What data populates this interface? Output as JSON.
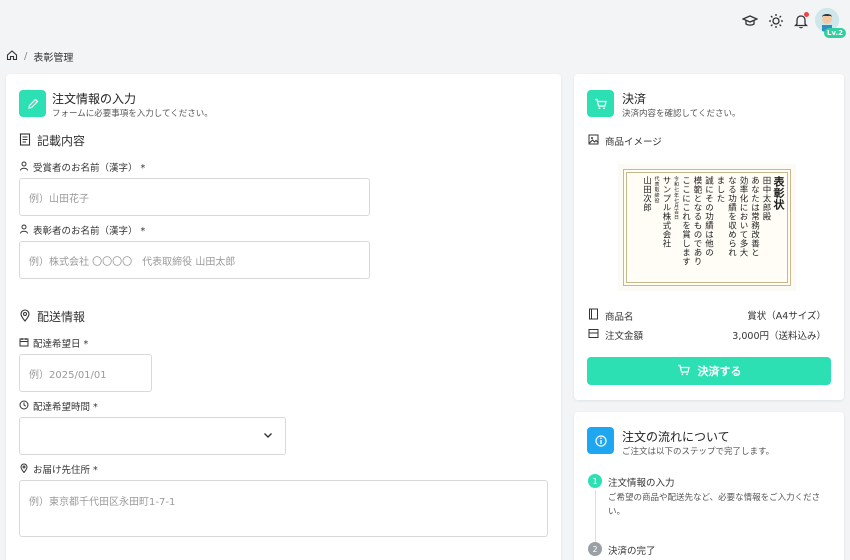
{
  "topbar": {
    "icons": [
      "graduation-cap-icon",
      "sun-icon",
      "bell-icon"
    ],
    "level_badge": "Lv.2"
  },
  "breadcrumb": {
    "home_icon": "home-icon",
    "separator": "/",
    "current": "表彰管理"
  },
  "order_form": {
    "title": "注文情報の入力",
    "subtitle": "フォームに必要事項を入力してください。",
    "entry_section": "記載内容",
    "recipient_label": "受賞者のお名前（漢字） *",
    "recipient_placeholder": "例）山田花子",
    "presenter_label": "表彰者のお名前（漢字） *",
    "presenter_placeholder": "例）株式会社 〇〇〇〇　代表取締役 山田太郎",
    "delivery_section": "配送情報",
    "date_label": "配達希望日 *",
    "date_placeholder": "例）2025/01/01",
    "time_label": "配達希望時間 *",
    "time_value": "",
    "address_label": "お届け先住所 *",
    "address_placeholder": "例）東京都千代田区永田町1-7-1"
  },
  "payment": {
    "title": "決済",
    "subtitle": "決済内容を確認してください。",
    "image_label": "商品イメージ",
    "certificate": {
      "title": "表彰状",
      "recipient": "田中太郎殿",
      "body": [
        "あなたは常務改善と",
        "効率化において多大",
        "なる功績を収められ",
        "ました",
        "誠にその功績は他の",
        "模範となるものであり",
        "ここにこれを賞します"
      ],
      "date": "令和七年七月吉日",
      "company": "サンプル株式会社",
      "signer_title": "代表取締役",
      "signer": "山田次郎"
    },
    "product_label": "商品名",
    "product_value": "賞状（A4サイズ）",
    "amount_label": "注文金額",
    "amount_value": "3,000円（送料込み）",
    "pay_button": "決済する"
  },
  "flow": {
    "title": "注文の流れについて",
    "subtitle": "ご注文は以下のステップで完了します。",
    "steps": [
      {
        "number": "1",
        "title": "注文情報の入力",
        "desc": "ご希望の商品や配送先など、必要な情報をご入力ください。"
      },
      {
        "number": "2",
        "title": "決済の完了"
      }
    ]
  },
  "colors": {
    "accent": "#2de0b4",
    "info": "#1ea7f0",
    "step_active": "#2de0b4",
    "step_inactive": "#9aa0a6"
  }
}
